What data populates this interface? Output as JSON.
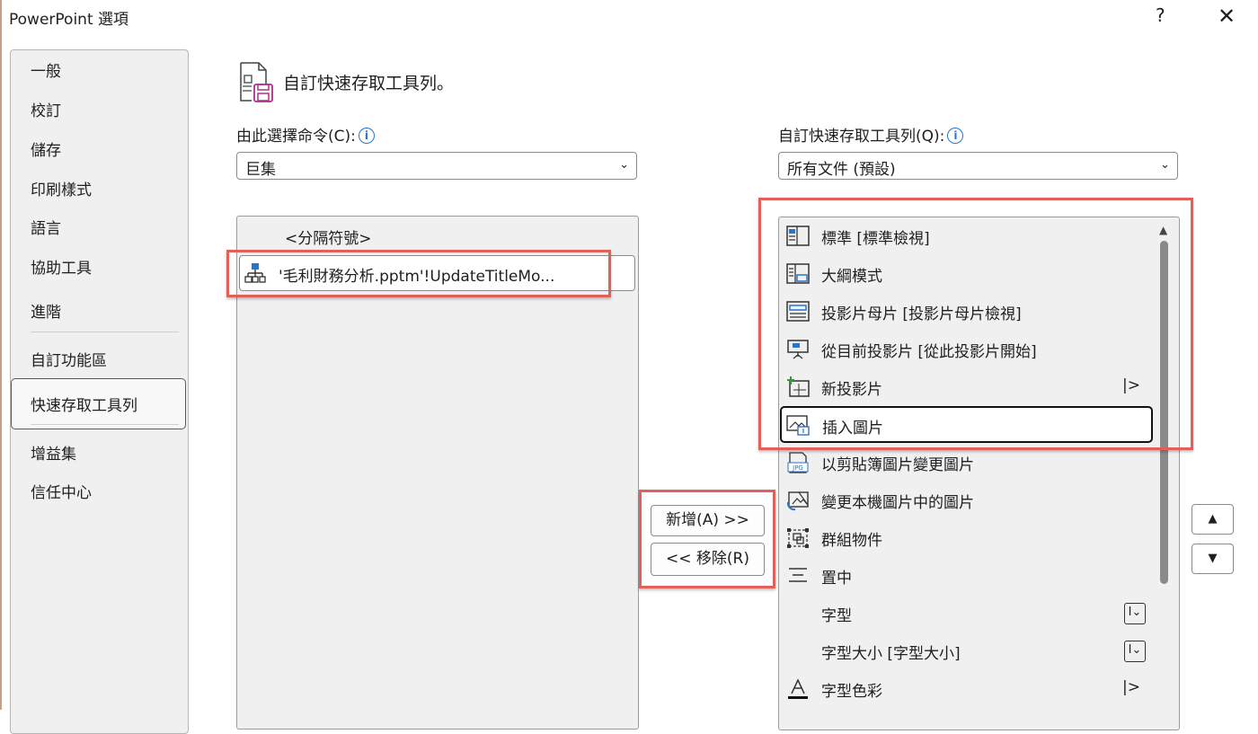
{
  "window": {
    "title": "PowerPoint 選項",
    "help_label": "?",
    "close_label": "✕"
  },
  "nav": {
    "items": [
      "一般",
      "校訂",
      "儲存",
      "印刷樣式",
      "語言",
      "協助工具",
      "進階",
      "自訂功能區",
      "快速存取工具列",
      "增益集",
      "信任中心"
    ],
    "selected": "快速存取工具列"
  },
  "header": {
    "title": "自訂快速存取工具列。"
  },
  "choose": {
    "label": "由此選擇命令(C):",
    "value": "巨集",
    "items": [
      "<分隔符號>",
      "'毛利財務分析.pptm'!UpdateTitleMo..."
    ]
  },
  "qat": {
    "label": "自訂快速存取工具列(Q):",
    "value": "所有文件 (預設)",
    "items": [
      {
        "label": "標準 [標準檢視]",
        "icon": "normal-view-icon"
      },
      {
        "label": "大綱模式",
        "icon": "outline-view-icon"
      },
      {
        "label": "投影片母片 [投影片母片檢視]",
        "icon": "slide-master-icon"
      },
      {
        "label": "從目前投影片 [從此投影片開始]",
        "icon": "from-current-slide-icon"
      },
      {
        "label": "新投影片",
        "icon": "new-slide-icon",
        "tail": "|>"
      },
      {
        "label": "插入圖片",
        "icon": "insert-picture-icon"
      },
      {
        "label": "以剪貼簿圖片變更圖片",
        "icon": "jpg-icon"
      },
      {
        "label": "變更本機圖片中的圖片",
        "icon": "change-picture-icon"
      },
      {
        "label": "群組物件",
        "icon": "group-icon"
      },
      {
        "label": "置中",
        "icon": "align-center-icon"
      },
      {
        "label": "字型",
        "icon": "",
        "tail": "I⌄"
      },
      {
        "label": "字型大小 [字型大小]",
        "icon": "",
        "tail": "I⌄"
      },
      {
        "label": "字型色彩",
        "icon": "font-color-icon",
        "tail": "|>"
      }
    ]
  },
  "buttons": {
    "add": "新增(A) >>",
    "remove": "<< 移除(R)",
    "up": "▲",
    "down": "▼"
  },
  "colors": {
    "highlight": "#e0605a",
    "info": "#2a74c9",
    "panel": "#f0f0f0"
  }
}
